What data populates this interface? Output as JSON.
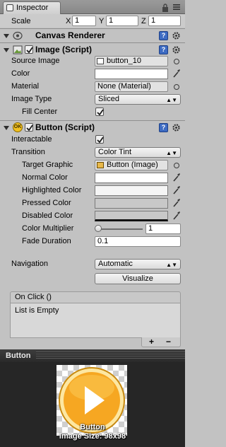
{
  "tab": {
    "title": "Inspector"
  },
  "transform": {
    "scale_label": "Scale",
    "x_label": "X",
    "x_value": "1",
    "y_label": "Y",
    "y_value": "1",
    "z_label": "Z",
    "z_value": "1"
  },
  "canvas_renderer": {
    "title": "Canvas Renderer"
  },
  "image": {
    "title": "Image (Script)",
    "source_image_label": "Source Image",
    "source_image_value": "button_10",
    "color_label": "Color",
    "material_label": "Material",
    "material_value": "None (Material)",
    "image_type_label": "Image Type",
    "image_type_value": "Sliced",
    "fill_center_label": "Fill Center"
  },
  "button": {
    "title": "Button (Script)",
    "badge": "OK",
    "interactable_label": "Interactable",
    "transition_label": "Transition",
    "transition_value": "Color Tint",
    "target_graphic_label": "Target Graphic",
    "target_graphic_value": "Button (Image)",
    "normal_color_label": "Normal Color",
    "highlighted_color_label": "Highlighted Color",
    "pressed_color_label": "Pressed Color",
    "disabled_color_label": "Disabled Color",
    "color_multiplier_label": "Color Multiplier",
    "color_multiplier_value": "1",
    "color_multiplier_fraction": 0.0,
    "fade_duration_label": "Fade Duration",
    "fade_duration_value": "0.1",
    "navigation_label": "Navigation",
    "navigation_value": "Automatic",
    "visualize_label": "Visualize",
    "on_click_title": "On Click ()",
    "on_click_empty": "List is Empty",
    "add_label": "+",
    "remove_label": "−"
  },
  "preview": {
    "title": "Button",
    "caption_name": "Button",
    "caption_size": "Image Size: 98x98"
  },
  "colors": {
    "normal": "#ffffff",
    "highlighted": "#f5f5f5",
    "pressed": "#c8c8c8",
    "disabled": "#c8c8c8",
    "button_orange": "#f6a722",
    "button_rim": "#fde7a1"
  }
}
